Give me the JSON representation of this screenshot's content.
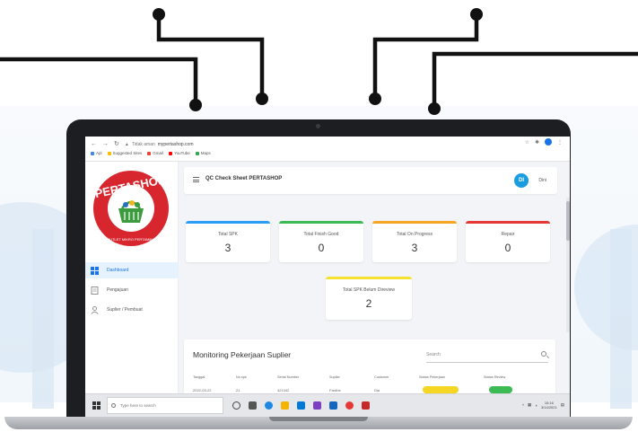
{
  "browser": {
    "url_prefix": "Tidak aman",
    "url": "mypertashop.com",
    "bookmarks": [
      "Apl",
      "Suggested Sites",
      "Gmail",
      "YouTube",
      "Maps"
    ]
  },
  "brand": {
    "logo_text": "PERTASHOP",
    "logo_ring_text": "OUTLET MIKRO PERTAMINA"
  },
  "sidebar": {
    "items": [
      {
        "label": "Dashboard",
        "icon": "dashboard-icon",
        "active": true
      },
      {
        "label": "Pengajuan",
        "icon": "document-icon",
        "active": false
      },
      {
        "label": "Suplier / Pembuat",
        "icon": "users-icon",
        "active": false
      }
    ]
  },
  "header": {
    "title": "QC Check Sheet PERTASHOP",
    "avatar_initials": "DI",
    "username": "Dini"
  },
  "stats": [
    {
      "label": "Total SPK",
      "value": "3",
      "color": "#2a9df4"
    },
    {
      "label": "Total Finish Good",
      "value": "0",
      "color": "#3cba54"
    },
    {
      "label": "Total On Progress",
      "value": "3",
      "color": "#f6a623"
    },
    {
      "label": "Repair",
      "value": "0",
      "color": "#e53935"
    },
    {
      "label": "Total SPK Belum Direview",
      "value": "2",
      "color": "#f5e130"
    }
  ],
  "table": {
    "title": "Monitoring Pekerjaan Suplier",
    "search_placeholder": "Search",
    "columns": [
      "Tanggal",
      "No spk",
      "Serial Number",
      "Suplier",
      "Customer",
      "Status Pekerjaan",
      "Status Review"
    ],
    "rows": [
      {
        "tanggal": "2022-03-22",
        "no_spk": "21",
        "serial": "421342",
        "suplier": "Fardhe",
        "customer": "Dia"
      }
    ]
  },
  "taskbar": {
    "search_placeholder": "Type here to search",
    "time": "10:16",
    "date": "3/14/2021"
  },
  "colors": {
    "accent": "#1a73e8",
    "status_progress": "#f5d623",
    "status_review": "#3cba54",
    "wire": "#111111"
  }
}
